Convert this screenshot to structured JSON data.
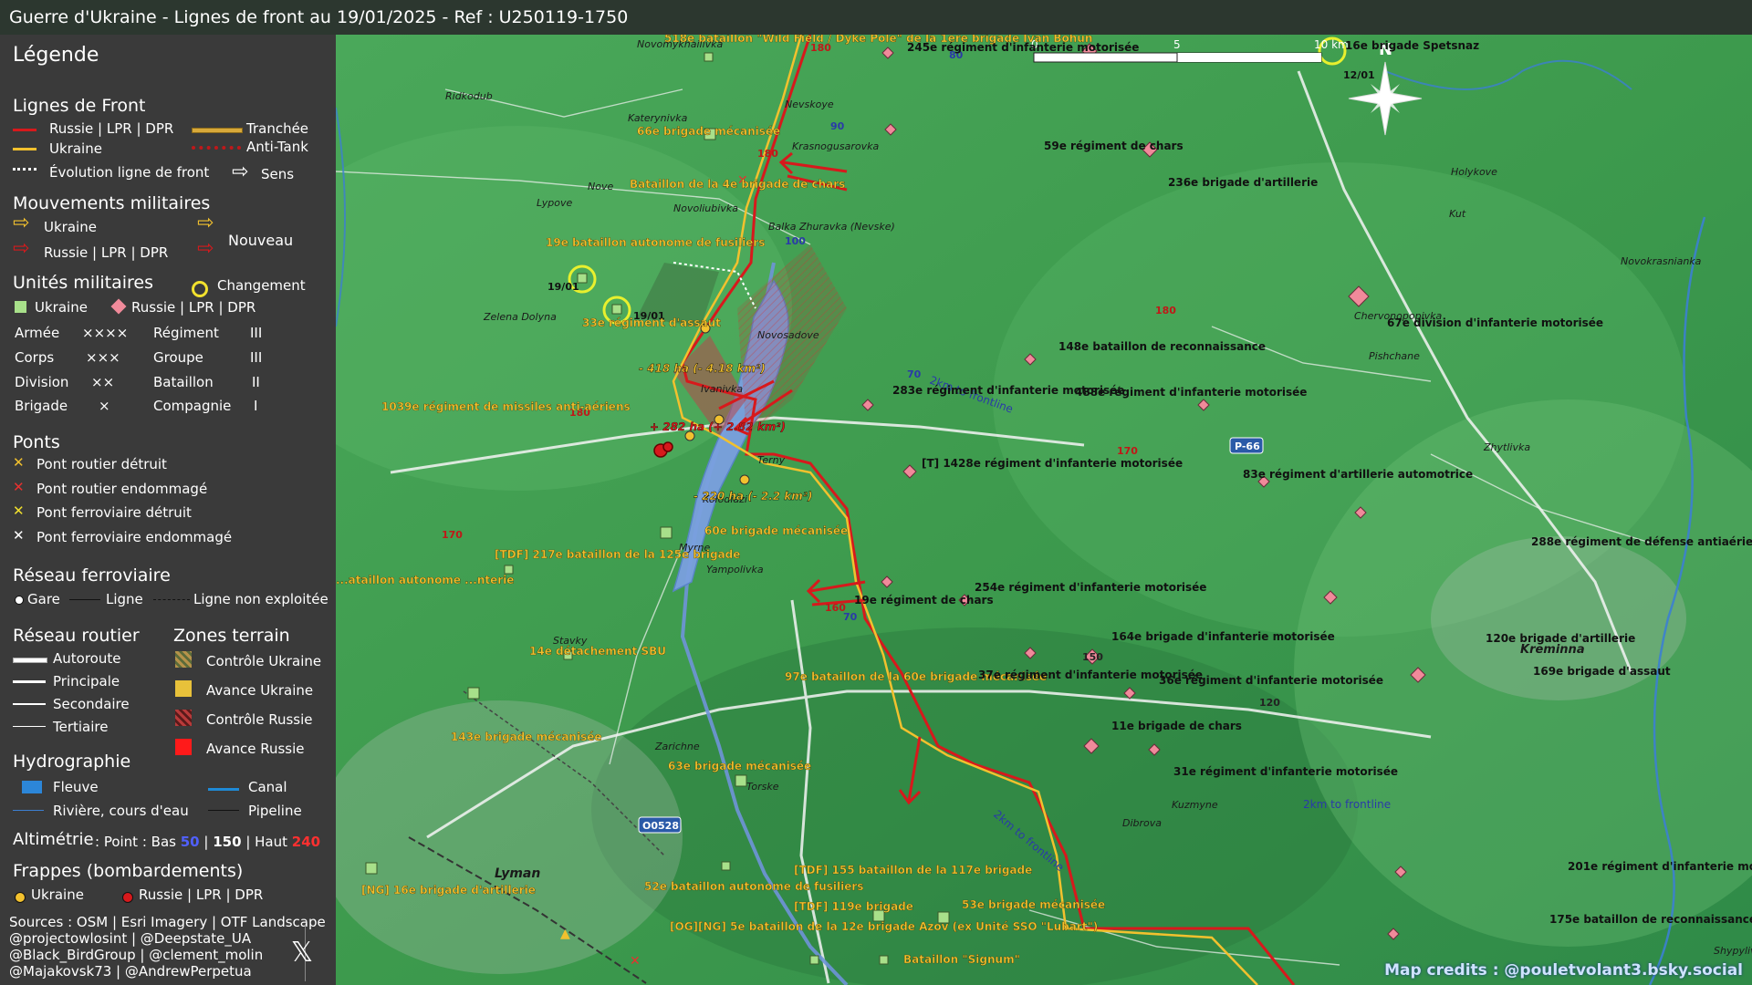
{
  "title": "Guerre d'Ukraine - Lignes de front au 19/01/2025 - Ref : U250119-1750",
  "colors": {
    "russia": "#d7191c",
    "ukraine": "#f2c12e",
    "river": "#6f94d8",
    "terrain": "#3f9d4f",
    "sidebar_bg": "#3a3a3a"
  },
  "legend": {
    "title": "Légende",
    "front_lines": {
      "heading": "Lignes de Front",
      "russia": "Russie | LPR | DPR",
      "ukraine": "Ukraine",
      "evolution": "Évolution ligne de front",
      "trench": "Tranchée",
      "antitank": "Anti-Tank",
      "direction": "Sens"
    },
    "movements": {
      "heading": "Mouvements militaires",
      "ukraine": "Ukraine",
      "russia": "Russie | LPR | DPR",
      "new": "Nouveau"
    },
    "units": {
      "heading": "Unités militaires",
      "change": "Changement",
      "ukraine": "Ukraine",
      "russia": "Russie | LPR | DPR",
      "rows": [
        {
          "left": "Armée",
          "left_sym": "××××",
          "right": "Régiment",
          "right_sym": "III"
        },
        {
          "left": "Corps",
          "left_sym": "×××",
          "right": "Groupe",
          "right_sym": "III"
        },
        {
          "left": "Division",
          "left_sym": "××",
          "right": "Bataillon",
          "right_sym": "II"
        },
        {
          "left": "Brigade",
          "left_sym": "×",
          "right": "Compagnie",
          "right_sym": "I"
        }
      ]
    },
    "bridges": {
      "heading": "Ponts",
      "items": [
        {
          "label": "Pont routier détruit",
          "color": "#f2c12e"
        },
        {
          "label": "Pont routier endommagé",
          "color": "#e8312f"
        },
        {
          "label": "Pont ferroviaire détruit",
          "color": "#f2e12e"
        },
        {
          "label": "Pont ferroviaire endommagé",
          "color": "#ffffff"
        }
      ]
    },
    "rail": {
      "heading": "Réseau ferroviaire",
      "station": "Gare",
      "line": "Ligne",
      "unused": "Ligne non exploitée"
    },
    "roads": {
      "heading": "Réseau routier",
      "items": [
        "Autoroute",
        "Principale",
        "Secondaire",
        "Tertiaire"
      ]
    },
    "terrain_zones": {
      "heading": "Zones terrain",
      "items": [
        {
          "label": "Contrôle Ukraine",
          "color": "#b5924a"
        },
        {
          "label": "Avance Ukraine",
          "color": "#e8c13a"
        },
        {
          "label": "Contrôle Russie",
          "color": "#b83a3a"
        },
        {
          "label": "Avance Russie",
          "color": "#ff1a1a"
        }
      ]
    },
    "hydro": {
      "heading": "Hydrographie",
      "river": "Fleuve",
      "canal": "Canal",
      "stream": "Rivière, cours d'eau",
      "pipeline": "Pipeline"
    },
    "altimetry": {
      "prefix": "Altimétrie",
      "text": ": Point : Bas",
      "low": "50",
      "sep1": "|",
      "mid": "150",
      "sep2": "| Haut",
      "high": "240"
    },
    "strikes": {
      "heading": "Frappes (bombardements)",
      "ukraine": "Ukraine",
      "russia": "Russie | LPR | DPR"
    },
    "sources": [
      "Sources : OSM | Esri Imagery | OTF Landscape",
      "@projectowlosint | @Deepstate_UA",
      "@Black_BirdGroup | @clement_molin",
      "@Majakovsk73 | @AndrewPerpetua"
    ],
    "x_icon": "𝕏"
  },
  "scale": {
    "labels": [
      "0",
      "5",
      "10 km"
    ]
  },
  "north": "N",
  "map_credit": "Map credits : @pouletvolant3.bsky.social",
  "map_labels": {
    "places": [
      "Novomykhailivka",
      "Nevskoye",
      "Ridkodub",
      "Katerynivka",
      "Nove",
      "Lypove",
      "Krasnogusarovka",
      "Novoliubivka",
      "Balka Zhuravka (Nevske)",
      "Zelena Dolyna",
      "Novosadove",
      "Ivanivka",
      "Terny",
      "Kolodiazi",
      "Myrne",
      "Yampolivka",
      "Stavky",
      "Zarichne",
      "Torske",
      "Lyman",
      "Dibrova",
      "Kuzmyne",
      "Kreminna",
      "Holykove",
      "Kut",
      "Chervonopopivka",
      "Pishchane",
      "Zhytlivka",
      "Novokrasnianka",
      "Shypylivka"
    ],
    "roads": [
      "P-66",
      "O0528"
    ],
    "altitudes": [
      "180",
      "90",
      "180",
      "100",
      "80",
      "70",
      "180",
      "170",
      "180",
      "170",
      "160",
      "150",
      "120",
      "70"
    ],
    "distances": [
      "2km to frontline",
      "2km to frontline",
      "2km to frontline"
    ],
    "dates": [
      "19/01",
      "19/01",
      "12/01"
    ],
    "area_changes": [
      "- 418 ha (- 4.18 km²)",
      "+ 282 ha (+ 2.82 km²)",
      "- 220 ha (- 2.2 km²)"
    ],
    "ukraine_units": [
      "518e bataillon \"Wild Field / Dyke Pole\" de la 1ère brigade Ivan Bohun",
      "66e brigade mécanisée",
      "Bataillon de la 4e brigade de chars",
      "19e bataillon autonome de fusiliers",
      "33e régiment d'assaut",
      "1039e régiment de missiles anti-aériens",
      "60e brigade mécanisée",
      "[TDF] 217e bataillon de la 125e brigade",
      "14e détachement SBU",
      "97e bataillon de la 60e brigade mécanisée",
      "143e brigade mécanisée",
      "63e brigade mécanisée",
      "52e bataillon autonome de fusiliers",
      "[TDF] 155 bataillon de la 117e brigade",
      "[TDF] 119e brigade",
      "53e brigade mécanisée",
      "[NG] 16e brigade d'artillerie",
      "[OG][NG] 5e bataillon de la 12e brigade Azov (ex Unité SSO \"Lubart\")",
      "Bataillon \"Signum\"",
      "...ataillon autonome ...nterie"
    ],
    "russia_units": [
      "245e régiment d'infanterie motorisée",
      "16e brigade Spetsnaz",
      "59e régiment de chars",
      "236e brigade d'artillerie",
      "148e bataillon de reconnaissance",
      "283e régiment d'infanterie motorisée",
      "488e régiment d'infanterie motorisée",
      "[T] 1428e régiment d'infanterie motorisée",
      "83e régiment d'artillerie automotrice",
      "67e division d'infanterie motorisée",
      "288e régiment de défense antiaérienne",
      "19e régiment de chars",
      "254e régiment d'infanterie motorisée",
      "164e brigade d'infanterie motorisée",
      "120e brigade d'artillerie",
      "37e régiment d'infanterie motorisée",
      "36e régiment d'infanterie motorisée",
      "169e brigade d'assaut",
      "11e brigade de chars",
      "31e régiment d'infanterie motorisée",
      "201e régiment d'infanterie motorisée",
      "175e bataillon de reconnaissance"
    ]
  }
}
